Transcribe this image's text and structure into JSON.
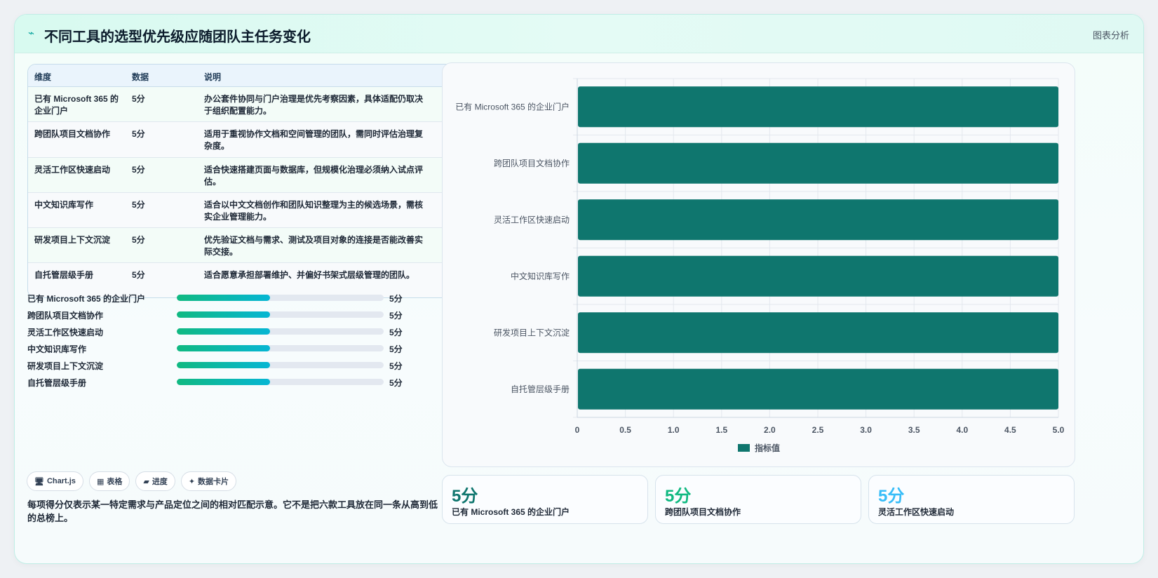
{
  "header": {
    "title": "不同工具的选型优先级应随团队主任务变化",
    "action": "图表分析"
  },
  "table": {
    "headers": [
      "维度",
      "数据",
      "说明"
    ],
    "rows": [
      [
        "已有 Microsoft 365 的企业门户",
        "5分",
        "办公套件协同与门户治理是优先考察因素，具体适配仍取决于组织配置能力。"
      ],
      [
        "跨团队项目文档协作",
        "5分",
        "适用于重视协作文档和空间管理的团队，需同时评估治理复杂度。"
      ],
      [
        "灵活工作区快速启动",
        "5分",
        "适合快速搭建页面与数据库，但规模化治理必须纳入试点评估。"
      ],
      [
        "中文知识库写作",
        "5分",
        "适合以中文文档创作和团队知识整理为主的候选场景，需核实企业管理能力。"
      ],
      [
        "研发项目上下文沉淀",
        "5分",
        "优先验证文档与需求、测试及项目对象的连接是否能改善实际交接。"
      ],
      [
        "自托管层级手册",
        "5分",
        "适合愿意承担部署维护、并偏好书架式层级管理的团队。"
      ]
    ]
  },
  "progress": [
    {
      "label": "已有 Microsoft 365 的企业门户",
      "value": "5分",
      "pct": 0.45
    },
    {
      "label": "跨团队项目文档协作",
      "value": "5分",
      "pct": 0.45
    },
    {
      "label": "灵活工作区快速启动",
      "value": "5分",
      "pct": 0.45
    },
    {
      "label": "中文知识库写作",
      "value": "5分",
      "pct": 0.45
    },
    {
      "label": "研发项目上下文沉淀",
      "value": "5分",
      "pct": 0.45
    },
    {
      "label": "自托管层级手册",
      "value": "5分",
      "pct": 0.45
    }
  ],
  "tags": [
    {
      "icon": "🖥",
      "label": "Chart.js"
    },
    {
      "icon": "▦",
      "label": "表格"
    },
    {
      "icon": "▰",
      "label": "进度"
    },
    {
      "icon": "✦",
      "label": "数据卡片"
    }
  ],
  "note": "每项得分仅表示某一特定需求与产品定位之间的相对匹配示意。它不是把六款工具放在同一条从高到低的总榜上。",
  "stats": [
    {
      "num": "5分",
      "cap": "已有 Microsoft 365 的企业门户",
      "color": "#0f766e"
    },
    {
      "num": "5分",
      "cap": "跨团队项目文档协作",
      "color": "#10b981"
    },
    {
      "num": "5分",
      "cap": "灵活工作区快速启动",
      "color": "#38bdf8"
    }
  ],
  "chart_data": {
    "type": "bar",
    "orientation": "horizontal",
    "categories": [
      "已有 Microsoft 365 的企业门户",
      "跨团队项目文档协作",
      "灵活工作区快速启动",
      "中文知识库写作",
      "研发项目上下文沉淀",
      "自托管层级手册"
    ],
    "series": [
      {
        "name": "指标值",
        "values": [
          5,
          5,
          5,
          5,
          5,
          5
        ],
        "color": "#0f766e"
      }
    ],
    "xlim": [
      0,
      5
    ],
    "xticks": [
      "0",
      "0.5",
      "1.0",
      "1.5",
      "2.0",
      "2.5",
      "3.0",
      "3.5",
      "4.0",
      "4.5",
      "5.0"
    ],
    "grid": true,
    "legend": "bottom"
  }
}
